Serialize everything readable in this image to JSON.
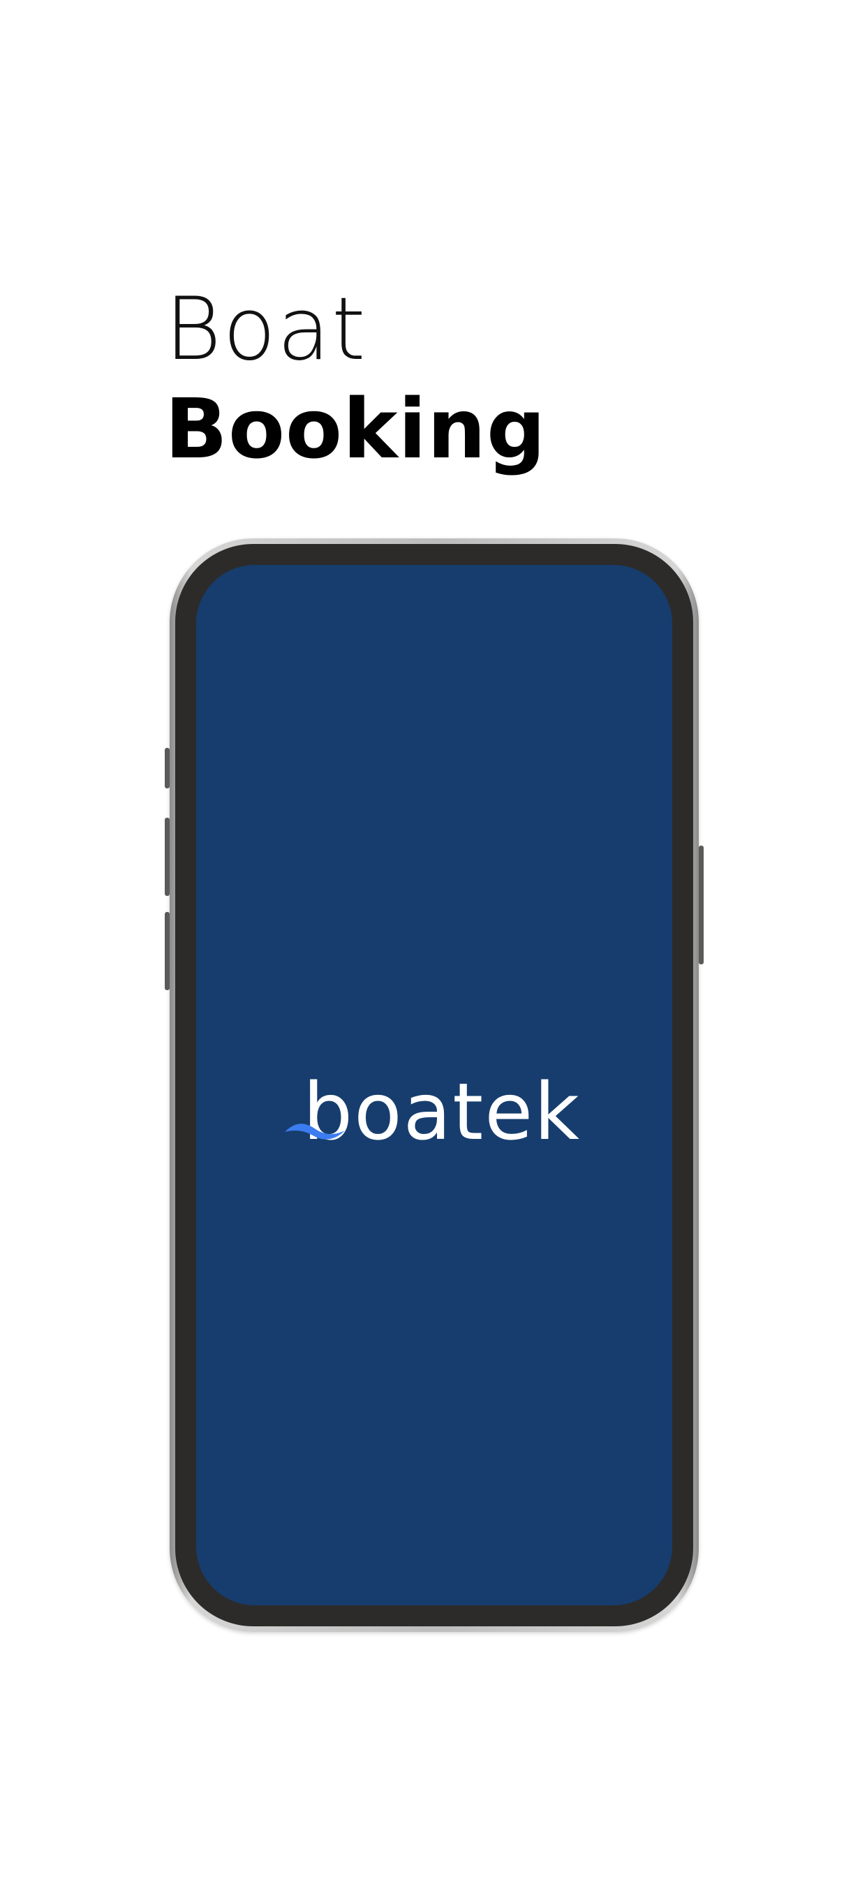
{
  "heading": {
    "line1": "Boat",
    "line2": "Booking"
  },
  "phone": {
    "screen_color": "#163d6d",
    "logo_text": "boatek",
    "logo_wave_color": "#3b7cf0",
    "logo_icon": "wave-icon"
  }
}
